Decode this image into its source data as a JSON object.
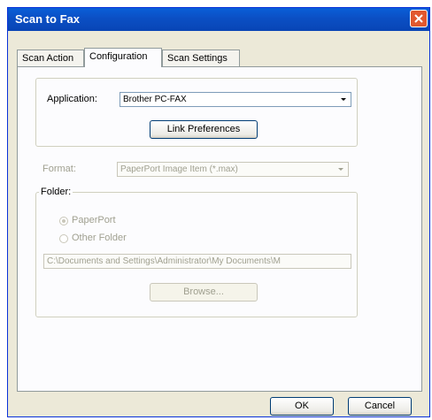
{
  "window": {
    "title": "Scan to Fax"
  },
  "tabs": [
    {
      "label": "Scan Action",
      "active": false
    },
    {
      "label": "Configuration",
      "active": true
    },
    {
      "label": "Scan Settings",
      "active": false
    }
  ],
  "application": {
    "label": "Application:",
    "value": "Brother PC-FAX",
    "link_button": "Link Preferences"
  },
  "format": {
    "label": "Format:",
    "value": "PaperPort Image Item (*.max)",
    "enabled": false
  },
  "folder": {
    "label": "Folder:",
    "options": [
      {
        "label": "PaperPort",
        "selected": true
      },
      {
        "label": "Other Folder",
        "selected": false
      }
    ],
    "path": "C:\\Documents and Settings\\Administrator\\My Documents\\M",
    "browse_button": "Browse...",
    "enabled": false
  },
  "footer": {
    "ok": "OK",
    "cancel": "Cancel"
  },
  "colors": {
    "titlebar": "#0a5fd8",
    "close": "#e2582f",
    "dialog": "#ece9d8",
    "panel": "#fcfcfe",
    "disabled_text": "#a0a090"
  }
}
